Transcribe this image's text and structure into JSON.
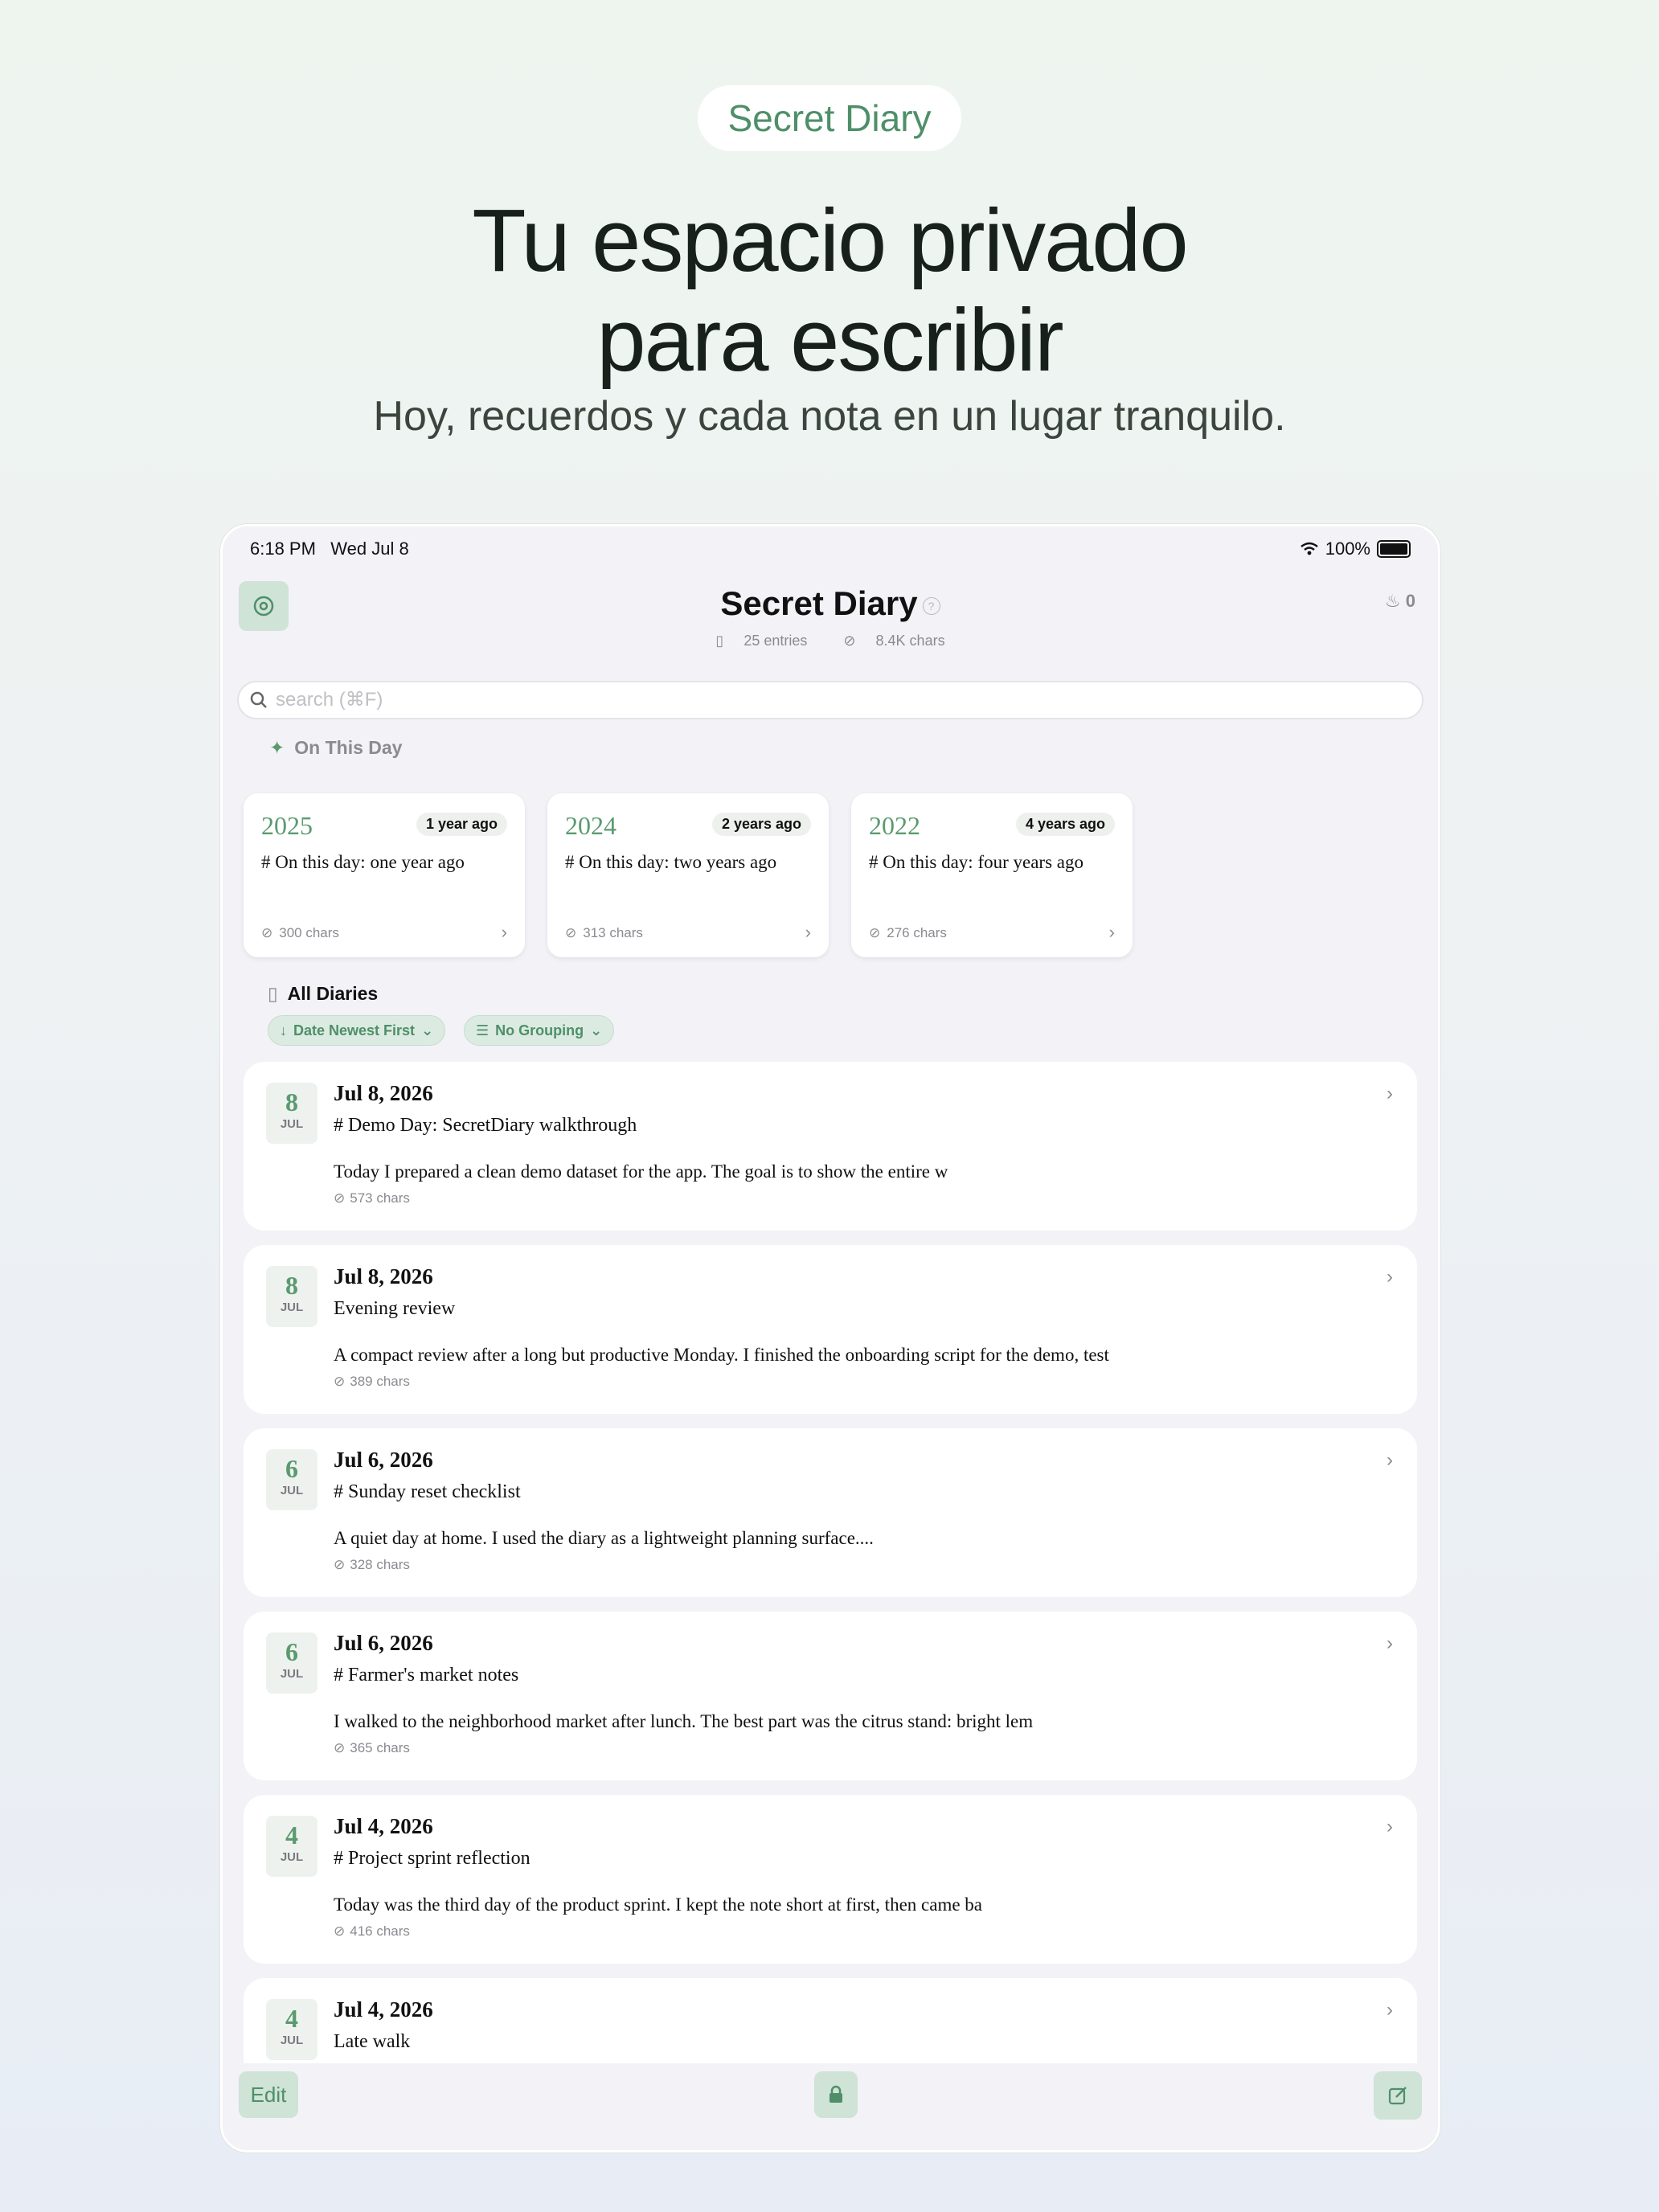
{
  "hero": {
    "app_label": "Secret Diary",
    "title_line1": "Tu espacio privado",
    "title_line2": "para escribir",
    "subtitle": "Hoy, recuerdos y cada nota en un lugar tranquilo."
  },
  "status_bar": {
    "time": "6:18 PM",
    "date": "Wed Jul 8",
    "battery": "100%"
  },
  "nav": {
    "title": "Secret Diary",
    "entries": "25 entries",
    "chars": "8.4K chars",
    "streak": "0"
  },
  "search": {
    "placeholder": "search (⌘F)"
  },
  "on_this_day": {
    "label": "On This Day",
    "cards": [
      {
        "year": "2025",
        "ago": "1 year ago",
        "title": "# On this day: one year ago",
        "chars": "300 chars"
      },
      {
        "year": "2024",
        "ago": "2 years ago",
        "title": "# On this day: two years ago",
        "chars": "313 chars"
      },
      {
        "year": "2022",
        "ago": "4 years ago",
        "title": "# On this day: four years ago",
        "chars": "276 chars"
      }
    ]
  },
  "all_diaries": {
    "label": "All Diaries",
    "sort_chip": "Date Newest First",
    "group_chip": "No Grouping"
  },
  "entries": [
    {
      "day": "8",
      "month": "JUL",
      "date": "Jul 8, 2026",
      "title": "# Demo Day: SecretDiary walkthrough",
      "preview": "Today I prepared a clean demo dataset for the app. The goal is to show the entire w",
      "chars": "573 chars"
    },
    {
      "day": "8",
      "month": "JUL",
      "date": "Jul 8, 2026",
      "title": "Evening review",
      "preview": "A compact review after a long but productive Monday. I finished the onboarding script for the demo, test",
      "chars": "389 chars"
    },
    {
      "day": "6",
      "month": "JUL",
      "date": "Jul 6, 2026",
      "title": "# Sunday reset checklist",
      "preview": "A quiet day at home. I used the diary as a lightweight planning surface....",
      "chars": "328 chars"
    },
    {
      "day": "6",
      "month": "JUL",
      "date": "Jul 6, 2026",
      "title": "# Farmer's market notes",
      "preview": "I walked to the neighborhood market after lunch. The best part was the citrus stand: bright lem",
      "chars": "365 chars"
    },
    {
      "day": "4",
      "month": "JUL",
      "date": "Jul 4, 2026",
      "title": "# Project sprint reflection",
      "preview": "Today was the third day of the product sprint. I kept the note short at first, then came ba",
      "chars": "416 chars"
    },
    {
      "day": "4",
      "month": "JUL",
      "date": "Jul 4, 2026",
      "title": "Late walk",
      "preview": "",
      "chars": ""
    }
  ],
  "toolbar": {
    "edit": "Edit"
  },
  "colors": {
    "accent": "#4e8f69",
    "accent_bg": "#cfe3d6"
  }
}
